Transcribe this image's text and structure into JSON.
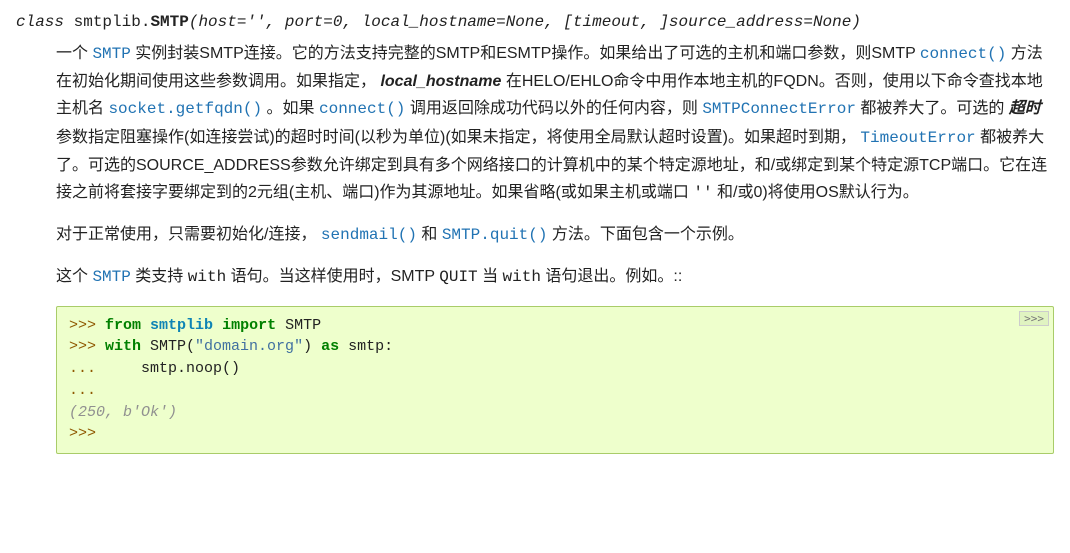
{
  "signature": {
    "keyword": "class",
    "module": "smtplib.",
    "classname": "SMTP",
    "params": "(host='', port=0, local_hostname=None, [timeout, ]source_address=None)"
  },
  "para1": {
    "t0": "一个 ",
    "link0": "SMTP",
    "t1": " 实例封装SMTP连接。它的方法支持完整的SMTP和ESMTP操作。如果给出了可选的主机和端口参数，则SMTP ",
    "link1": "connect()",
    "t2": " 方法在初始化期间使用这些参数调用。如果指定， ",
    "em0": "local_hostname",
    "t3": " 在HELO/EHLO命令中用作本地主机的FQDN。否则，使用以下命令查找本地主机名 ",
    "link2": "socket.getfqdn()",
    "t4": " 。如果 ",
    "link3": "connect()",
    "t5": " 调用返回除成功代码以外的任何内容，则 ",
    "link4": "SMTPConnectError",
    "t6": " 都被养大了。可选的 ",
    "em1": "超时",
    "t7": " 参数指定阻塞操作(如连接尝试)的超时时间(以秒为单位)(如果未指定，将使用全局默认超时设置)。如果超时到期， ",
    "link5": "TimeoutError",
    "t8": " 都被养大了。可选的SOURCE_ADDRESS参数允许绑定到具有多个网络接口的计算机中的某个特定源地址，和/或绑定到某个特定源TCP端口。它在连接之前将套接字要绑定到的2元组(主机、端口)作为其源地址。如果省略(或如果主机或端口 ",
    "lit0": "''",
    "t9": " 和/或0)将使用OS默认行为。"
  },
  "para2": {
    "t0": "对于正常使用，只需要初始化/连接， ",
    "link0": "sendmail()",
    "t1": " 和 ",
    "link1": "SMTP.quit()",
    "t2": " 方法。下面包含一个示例。"
  },
  "para3": {
    "t0": "这个 ",
    "link0": "SMTP",
    "t1": " 类支持 ",
    "lit0": "with",
    "t2": " 语句。当这样使用时，SMTP ",
    "lit1": "QUIT",
    "t3": " 当 ",
    "lit2": "with",
    "t4": " 语句退出。例如。::"
  },
  "code": {
    "copylabel": ">>>",
    "line1": {
      "prompt": ">>> ",
      "kw1": "from",
      "sp1": " ",
      "mod": "smtplib",
      "sp2": " ",
      "kw2": "import",
      "rest": " SMTP"
    },
    "line2": {
      "prompt": ">>> ",
      "kw1": "with",
      "sp1": " SMTP(",
      "str": "\"domain.org\"",
      "sp2": ") ",
      "kw2": "as",
      "rest": " smtp:"
    },
    "line3": {
      "prompt": "... ",
      "rest": "    smtp.noop()"
    },
    "line4": {
      "prompt": "..."
    },
    "line5": {
      "out": "(250, b'Ok')"
    },
    "line6": {
      "prompt": ">>>"
    }
  }
}
